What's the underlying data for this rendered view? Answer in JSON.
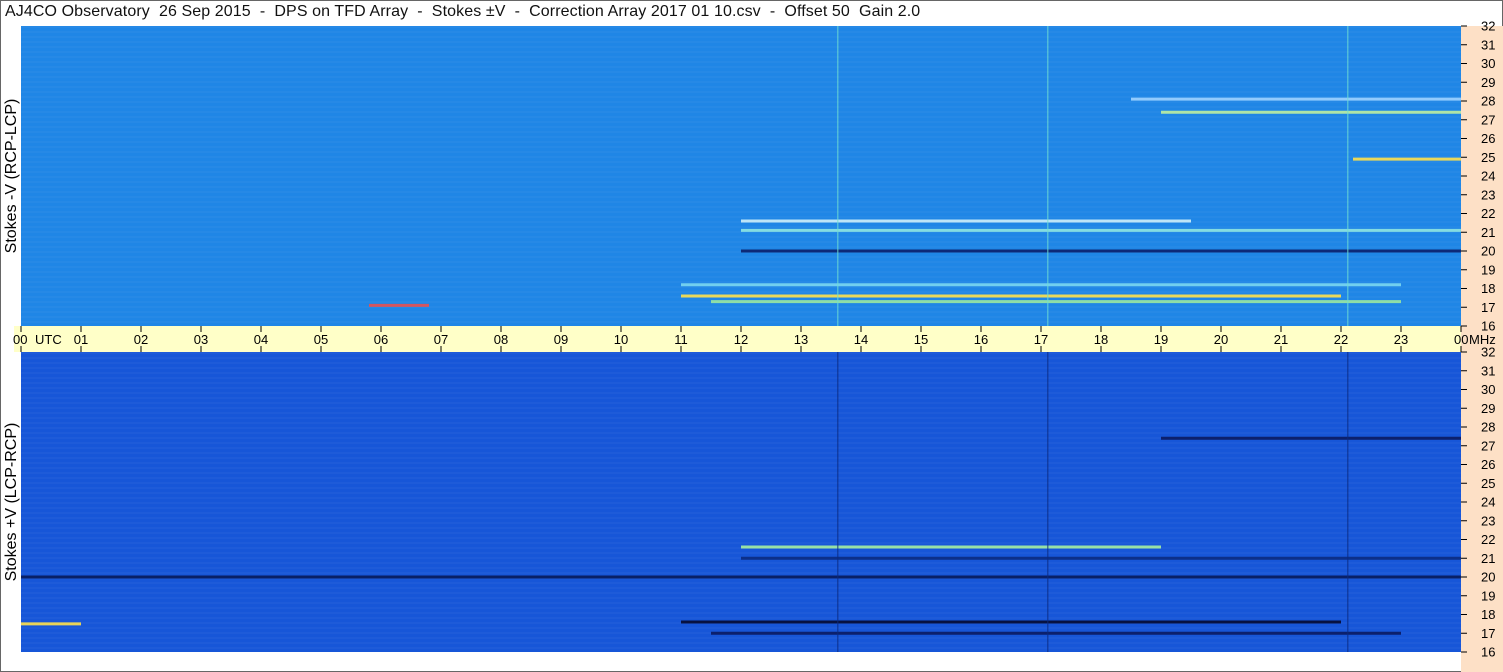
{
  "window": {
    "title": "AJ4CO Observatory  26 Sep 2015  -  DPS on TFD Array  -  Stokes ±V  -  Correction Array 2017 01 10.csv  -  Offset 50  Gain 2.0"
  },
  "chart_data": [
    {
      "type": "heatmap",
      "panel": "top",
      "ylabel": "Stokes -V (RCP-LCP)",
      "y_ticks": [
        32,
        31,
        30,
        29,
        28,
        27,
        26,
        25,
        24,
        23,
        22,
        21,
        20,
        19,
        18,
        17,
        16
      ],
      "ylim": [
        16,
        32
      ],
      "xlim": [
        0,
        24
      ],
      "background_color": "#1f86e6",
      "bands": [
        {
          "freq": 17.6,
          "t_start": 11.0,
          "t_end": 22.0,
          "color": "#ffe14a"
        },
        {
          "freq": 17.3,
          "t_start": 11.5,
          "t_end": 23.0,
          "color": "#9be8a0"
        },
        {
          "freq": 18.2,
          "t_start": 11.0,
          "t_end": 23.0,
          "color": "#7ad7f0"
        },
        {
          "freq": 20.0,
          "t_start": 12.0,
          "t_end": 24.0,
          "color": "#0b1f6a"
        },
        {
          "freq": 21.1,
          "t_start": 12.0,
          "t_end": 24.0,
          "color": "#8fe6e0"
        },
        {
          "freq": 21.6,
          "t_start": 12.0,
          "t_end": 19.5,
          "color": "#cfeff8"
        },
        {
          "freq": 28.1,
          "t_start": 18.5,
          "t_end": 24.0,
          "color": "#9fd3ff"
        },
        {
          "freq": 27.4,
          "t_start": 19.0,
          "t_end": 24.0,
          "color": "#bff0a0"
        },
        {
          "freq": 24.9,
          "t_start": 22.2,
          "t_end": 24.0,
          "color": "#ffe14a"
        },
        {
          "freq": 17.1,
          "t_start": 5.8,
          "t_end": 6.8,
          "color": "#e85050"
        }
      ]
    },
    {
      "type": "heatmap",
      "panel": "bottom",
      "ylabel": "Stokes +V (LCP-RCP)",
      "y_ticks": [
        32,
        31,
        30,
        29,
        28,
        27,
        26,
        25,
        24,
        23,
        22,
        21,
        20,
        19,
        18,
        17,
        16
      ],
      "ylim": [
        16,
        32
      ],
      "xlim": [
        0,
        24
      ],
      "background_color": "#1756d8",
      "bands": [
        {
          "freq": 17.6,
          "t_start": 11.0,
          "t_end": 22.0,
          "color": "#050a30"
        },
        {
          "freq": 17.0,
          "t_start": 11.5,
          "t_end": 23.0,
          "color": "#0a1a60"
        },
        {
          "freq": 20.0,
          "t_start": 0.0,
          "t_end": 24.0,
          "color": "#071a5a"
        },
        {
          "freq": 21.6,
          "t_start": 12.0,
          "t_end": 19.0,
          "color": "#a6f0a0"
        },
        {
          "freq": 21.0,
          "t_start": 12.0,
          "t_end": 24.0,
          "color": "#0a2a80"
        },
        {
          "freq": 27.4,
          "t_start": 19.0,
          "t_end": 24.0,
          "color": "#0a1a60"
        },
        {
          "freq": 17.5,
          "t_start": 0.0,
          "t_end": 1.0,
          "color": "#ffe14a"
        }
      ]
    }
  ],
  "time_axis": {
    "labels": [
      "00",
      "01",
      "02",
      "03",
      "04",
      "05",
      "06",
      "07",
      "08",
      "09",
      "10",
      "11",
      "12",
      "13",
      "14",
      "15",
      "16",
      "17",
      "18",
      "19",
      "20",
      "21",
      "22",
      "23",
      "00"
    ],
    "utc_label": "UTC",
    "mhz_label": "MHz",
    "strip_color": "#ffffc8"
  },
  "right_axis_color": "#fde0c6"
}
